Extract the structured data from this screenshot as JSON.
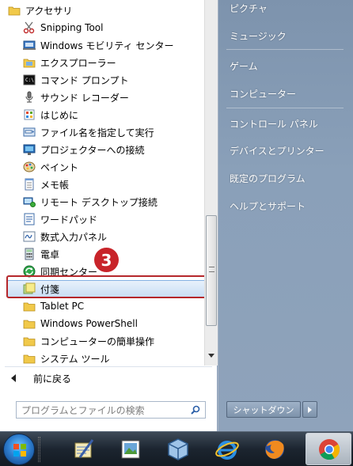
{
  "start_menu": {
    "programs": [
      {
        "label": "アクセサリ",
        "icon": "folder-icon",
        "level": 0
      },
      {
        "label": "Snipping Tool",
        "icon": "scissors-icon",
        "level": 1
      },
      {
        "label": "Windows モビリティ センター",
        "icon": "mobility-center-icon",
        "level": 1
      },
      {
        "label": "エクスプローラー",
        "icon": "explorer-folder-icon",
        "level": 1
      },
      {
        "label": "コマンド プロンプト",
        "icon": "command-prompt-icon",
        "level": 1
      },
      {
        "label": "サウンド レコーダー",
        "icon": "microphone-icon",
        "level": 1
      },
      {
        "label": "はじめに",
        "icon": "getting-started-icon",
        "level": 1
      },
      {
        "label": "ファイル名を指定して実行",
        "icon": "run-icon",
        "level": 1
      },
      {
        "label": "プロジェクターへの接続",
        "icon": "projector-icon",
        "level": 1
      },
      {
        "label": "ペイント",
        "icon": "paint-palette-icon",
        "level": 1
      },
      {
        "label": "メモ帳",
        "icon": "notepad-icon",
        "level": 1
      },
      {
        "label": "リモート デスクトップ接続",
        "icon": "remote-desktop-icon",
        "level": 1
      },
      {
        "label": "ワードパッド",
        "icon": "wordpad-icon",
        "level": 1
      },
      {
        "label": "数式入力パネル",
        "icon": "math-input-icon",
        "level": 1
      },
      {
        "label": "電卓",
        "icon": "calculator-icon",
        "level": 1
      },
      {
        "label": "同期センター",
        "icon": "sync-center-icon",
        "level": 1
      },
      {
        "label": "付箋",
        "icon": "sticky-notes-icon",
        "level": 1,
        "selected": true
      },
      {
        "label": "Tablet PC",
        "icon": "folder-icon",
        "level": 1
      },
      {
        "label": "Windows PowerShell",
        "icon": "folder-icon",
        "level": 1
      },
      {
        "label": "コンピューターの簡単操作",
        "icon": "folder-icon",
        "level": 1
      },
      {
        "label": "システム ツール",
        "icon": "folder-icon",
        "level": 1
      }
    ],
    "back_label": "前に戻る",
    "search_placeholder": "プログラムとファイルの検索",
    "step_badge": "3",
    "right_items": [
      "ピクチャ",
      "ミュージック",
      "ゲーム",
      "コンピューター",
      "コントロール パネル",
      "デバイスとプリンター",
      "既定のプログラム",
      "ヘルプとサポート"
    ],
    "shutdown_label": "シャットダウン"
  },
  "taskbar": {
    "items": [
      {
        "name": "start-button",
        "icon": "windows-orb-icon"
      },
      {
        "name": "handwriting-app",
        "icon": "pen-notepad-icon"
      },
      {
        "name": "picture-viewer",
        "icon": "picture-viewer-icon"
      },
      {
        "name": "virtualbox",
        "icon": "cube-icon"
      },
      {
        "name": "internet-explorer",
        "icon": "internet-explorer-icon"
      },
      {
        "name": "firefox",
        "icon": "firefox-icon"
      },
      {
        "name": "chrome",
        "icon": "chrome-icon"
      }
    ]
  },
  "colors": {
    "highlight_border": "#b5272b",
    "badge": "#c8242a",
    "selection": "#c9def5",
    "right_pane": "#8aa0b9",
    "taskbar": "#1c2530"
  }
}
